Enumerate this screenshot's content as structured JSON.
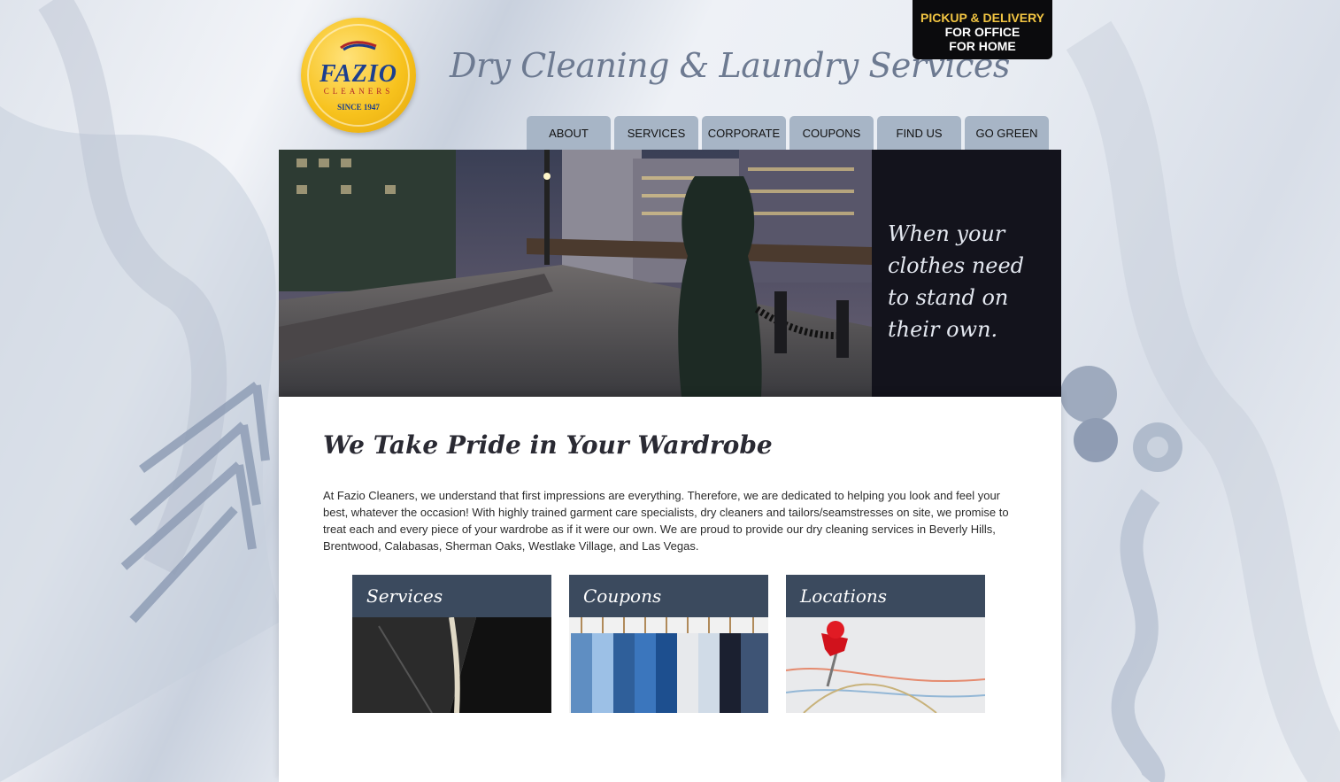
{
  "brand": {
    "logo_name": "FAZIO",
    "logo_sub": "CLEANERS",
    "logo_since": "SINCE 1947",
    "tagline": "Dry Cleaning & Laundry Services"
  },
  "pickup": {
    "line1": "PICKUP & DELIVERY",
    "line2": "FOR OFFICE",
    "line3": "FOR HOME"
  },
  "nav": {
    "items": [
      {
        "label": "ABOUT"
      },
      {
        "label": "SERVICES"
      },
      {
        "label": "CORPORATE"
      },
      {
        "label": "COUPONS"
      },
      {
        "label": "FIND US"
      },
      {
        "label": "GO GREEN"
      }
    ]
  },
  "hero": {
    "quote": "When your clothes need to stand on their own."
  },
  "main": {
    "heading": "We Take Pride in Your Wardrobe",
    "intro": "At Fazio Cleaners, we understand that first impressions are everything. Therefore, we are dedicated to helping you look and feel your best, whatever the occasion! With highly trained garment care specialists, dry cleaners and tailors/seamstresses on site, we promise to treat each and every piece of your wardrobe as if it were our own. We are proud to provide our dry cleaning services in Beverly Hills, Brentwood, Calabasas, Sherman Oaks, Westlake Village, and Las Vegas."
  },
  "cards": [
    {
      "label": "Services"
    },
    {
      "label": "Coupons"
    },
    {
      "label": "Locations"
    }
  ],
  "colors": {
    "nav_tab": "#a7b5c6",
    "card_bar": "#3b4a5e",
    "pickup_accent": "#f2c542"
  }
}
